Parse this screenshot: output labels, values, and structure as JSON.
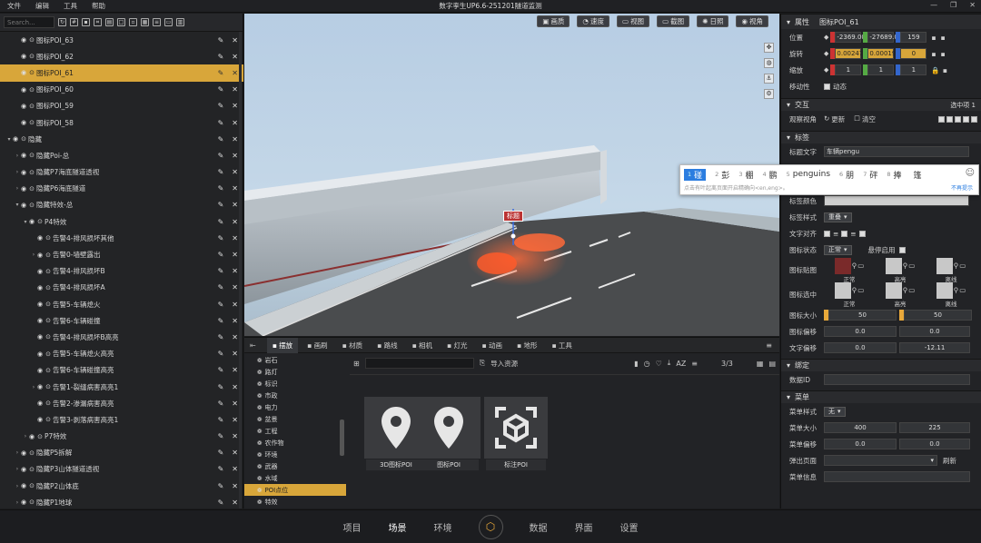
{
  "titlebar": {
    "menus": [
      "文件",
      "编辑",
      "工具",
      "帮助"
    ],
    "title": "数字孪生UP6.6-251201隧道监测"
  },
  "left": {
    "search_placeholder": "Search...",
    "tree": [
      {
        "label": "图标POI_63",
        "indent": 1,
        "arrow": "",
        "selected": false
      },
      {
        "label": "图标POI_62",
        "indent": 1,
        "arrow": "",
        "selected": false
      },
      {
        "label": "图标POI_61",
        "indent": 1,
        "arrow": "",
        "selected": true
      },
      {
        "label": "图标POI_60",
        "indent": 1,
        "arrow": "",
        "selected": false
      },
      {
        "label": "图标POI_59",
        "indent": 1,
        "arrow": "",
        "selected": false
      },
      {
        "label": "图标POI_58",
        "indent": 1,
        "arrow": "",
        "selected": false
      },
      {
        "label": "隐藏",
        "indent": 0,
        "arrow": "▾",
        "selected": false
      },
      {
        "label": "隐藏Poi-总",
        "indent": 1,
        "arrow": "›",
        "selected": false
      },
      {
        "label": "隐藏P7海底隧道透视",
        "indent": 1,
        "arrow": "›",
        "selected": false
      },
      {
        "label": "隐藏P6海底隧道",
        "indent": 1,
        "arrow": "›",
        "selected": false
      },
      {
        "label": "隐藏特效-总",
        "indent": 1,
        "arrow": "▾",
        "selected": false
      },
      {
        "label": "P4特效",
        "indent": 2,
        "arrow": "▾",
        "selected": false
      },
      {
        "label": "告警4-排风损坏其他",
        "indent": 3,
        "arrow": "",
        "selected": false
      },
      {
        "label": "告警0-墙壁露出",
        "indent": 3,
        "arrow": "›",
        "selected": false
      },
      {
        "label": "告警4-排风损坏B",
        "indent": 3,
        "arrow": "",
        "selected": false
      },
      {
        "label": "告警4-排风损坏A",
        "indent": 3,
        "arrow": "",
        "selected": false
      },
      {
        "label": "告警5-车辆熄火",
        "indent": 3,
        "arrow": "",
        "selected": false
      },
      {
        "label": "告警6-车辆碰撞",
        "indent": 3,
        "arrow": "",
        "selected": false
      },
      {
        "label": "告警4-排风损坏B高亮",
        "indent": 3,
        "arrow": "",
        "selected": false
      },
      {
        "label": "告警5-车辆熄火高亮",
        "indent": 3,
        "arrow": "",
        "selected": false
      },
      {
        "label": "告警6-车辆碰撞高亮",
        "indent": 3,
        "arrow": "",
        "selected": false
      },
      {
        "label": "告警1-裂缝病害高亮1",
        "indent": 3,
        "arrow": "›",
        "selected": false
      },
      {
        "label": "告警2-渗漏病害高亮",
        "indent": 3,
        "arrow": "",
        "selected": false
      },
      {
        "label": "告警3-剥落病害高亮1",
        "indent": 3,
        "arrow": "",
        "selected": false
      },
      {
        "label": "P7特效",
        "indent": 2,
        "arrow": "›",
        "selected": false
      },
      {
        "label": "隐藏P5拆解",
        "indent": 1,
        "arrow": "›",
        "selected": false
      },
      {
        "label": "隐藏P3山体隧道透视",
        "indent": 1,
        "arrow": "›",
        "selected": false
      },
      {
        "label": "隐藏P2山体底",
        "indent": 1,
        "arrow": "›",
        "selected": false
      },
      {
        "label": "隐藏P1地球",
        "indent": 1,
        "arrow": "›",
        "selected": false
      }
    ]
  },
  "viewport": {
    "buttons": [
      {
        "label": "画质",
        "icon": "picture-quality-icon",
        "glyph": "▣"
      },
      {
        "label": "速度",
        "icon": "speed-icon",
        "glyph": "◔"
      },
      {
        "label": "视图",
        "icon": "view-icon",
        "glyph": "▭"
      },
      {
        "label": "截图",
        "icon": "screenshot-icon",
        "glyph": "▭"
      },
      {
        "label": "日照",
        "icon": "sun-icon",
        "glyph": "✺"
      },
      {
        "label": "视角",
        "icon": "eye-icon",
        "glyph": "◉"
      }
    ],
    "label_tag": "标题"
  },
  "dock": {
    "tabs": [
      {
        "label": "摆放",
        "active": true
      },
      {
        "label": "画刷",
        "active": false
      },
      {
        "label": "材质",
        "active": false
      },
      {
        "label": "路线",
        "active": false
      },
      {
        "label": "相机",
        "active": false
      },
      {
        "label": "灯光",
        "active": false
      },
      {
        "label": "动画",
        "active": false
      },
      {
        "label": "地形",
        "active": false
      },
      {
        "label": "工具",
        "active": false
      }
    ],
    "categories": [
      {
        "label": "岩石",
        "active": false
      },
      {
        "label": "路灯",
        "active": false
      },
      {
        "label": "标识",
        "active": false
      },
      {
        "label": "市政",
        "active": false
      },
      {
        "label": "电力",
        "active": false
      },
      {
        "label": "盆景",
        "active": false
      },
      {
        "label": "工程",
        "active": false
      },
      {
        "label": "农作物",
        "active": false
      },
      {
        "label": "环境",
        "active": false
      },
      {
        "label": "武器",
        "active": false
      },
      {
        "label": "水域",
        "active": false
      },
      {
        "label": "POI点位",
        "active": true
      },
      {
        "label": "特效",
        "active": false
      }
    ],
    "import_label": "导入资源",
    "page": "3/3",
    "assets": [
      {
        "label": "3D图标POI",
        "icon": "map-pin-icon"
      },
      {
        "label": "图标POI",
        "icon": "map-pin-icon"
      },
      {
        "label": "标注POI",
        "icon": "cube-frame-icon"
      }
    ]
  },
  "right": {
    "header": {
      "section": "属性",
      "name": "图标POI_61"
    },
    "transform": {
      "position": {
        "label": "位置",
        "x": "-2369.00",
        "y": "-27689.00",
        "z": "159"
      },
      "rotation": {
        "label": "旋转",
        "x": "0.002473",
        "y": "0.000191",
        "z": "0"
      },
      "scale": {
        "label": "缩放",
        "x": "1",
        "y": "1",
        "z": "1"
      },
      "mobility": {
        "label": "移动性",
        "value": "动态"
      }
    },
    "interact": {
      "section": "交互",
      "selected": "选中项 1",
      "observe_label": "观察视角",
      "update": "更新",
      "clear": "清空"
    },
    "label": {
      "section": "标签",
      "text_label": "标题文字",
      "text_value": "车辆pengu",
      "color_label": "标签颜色",
      "style_label": "标签样式",
      "style_value": "重叠",
      "align_label": "文字对齐",
      "icon_state_label": "图标状态",
      "icon_state_value": "正常",
      "hover_label": "悬停启用",
      "icon_map_label": "图标贴图",
      "icon_select_label": "图标选中",
      "state_normal": "正常",
      "state_highlight": "高亮",
      "state_offline": "离线",
      "icon_size_label": "图标大小",
      "icon_size_a": "50",
      "icon_size_b": "50",
      "icon_offset_label": "图标偏移",
      "icon_offset_a": "0.0",
      "icon_offset_b": "0.0",
      "text_offset_label": "文字偏移",
      "text_offset_a": "0.0",
      "text_offset_b": "-12.11"
    },
    "bind": {
      "section": "绑定",
      "data_id_label": "数据ID"
    },
    "menu": {
      "section": "菜单",
      "style_label": "菜单样式",
      "style_value": "无",
      "size_label": "菜单大小",
      "size_a": "400",
      "size_b": "225",
      "offset_label": "菜单偏移",
      "offset_a": "0.0",
      "offset_b": "0.0",
      "popup_label": "弹出页面",
      "refresh": "刷新",
      "info_label": "菜单信息"
    }
  },
  "ime": {
    "candidates": [
      {
        "n": "1",
        "t": "碰"
      },
      {
        "n": "2",
        "t": "彭"
      },
      {
        "n": "3",
        "t": "棚"
      },
      {
        "n": "4",
        "t": "鹏"
      },
      {
        "n": "5",
        "t": "penguins"
      },
      {
        "n": "6",
        "t": "朋"
      },
      {
        "n": "7",
        "t": "砰"
      },
      {
        "n": "8",
        "t": "捧"
      },
      {
        "n": "",
        "t": "篷"
      }
    ],
    "hint": "点击有叶起离页面开启精确向<en,eng>。",
    "hint_right": "不再提示"
  },
  "bottom_nav": {
    "items": [
      "项目",
      "场景",
      "环境",
      "数据",
      "界面",
      "设置"
    ],
    "active": "场景"
  }
}
